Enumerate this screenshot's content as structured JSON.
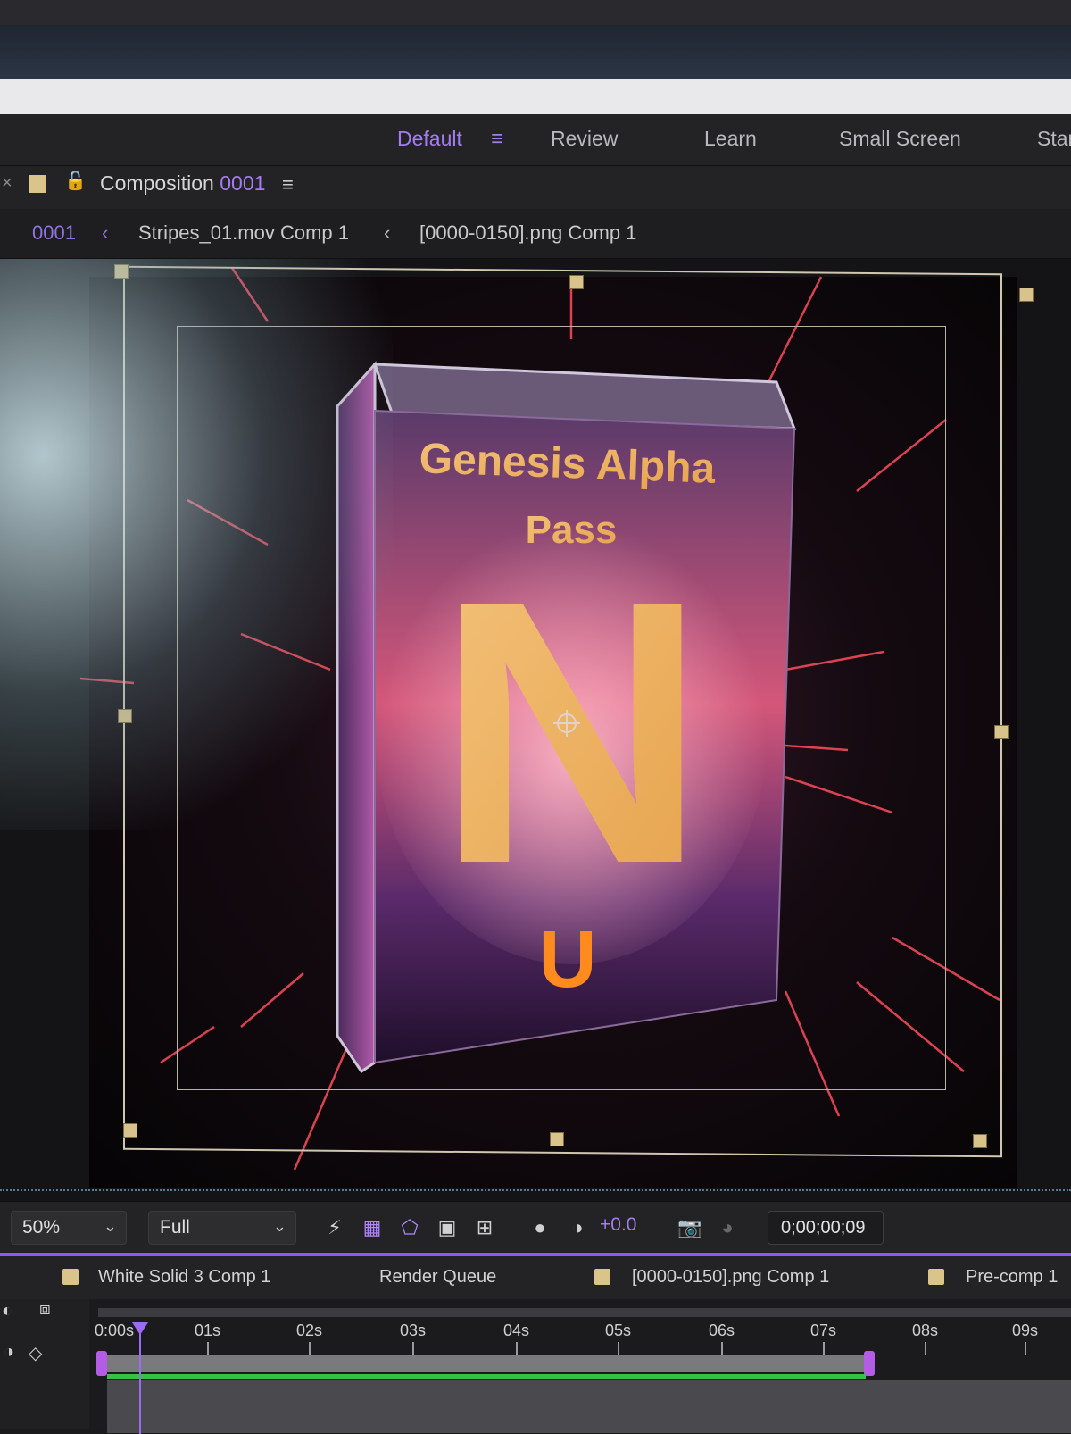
{
  "workspaces": [
    {
      "label": "Default",
      "active": true
    },
    {
      "label": "Review",
      "active": false
    },
    {
      "label": "Learn",
      "active": false
    },
    {
      "label": "Small Screen",
      "active": false
    },
    {
      "label": "Star",
      "active": false
    }
  ],
  "panel": {
    "title": "Composition",
    "comp_number": "0001"
  },
  "breadcrumbs": [
    "0001",
    "Stripes_01.mov Comp 1",
    "[0000-0150].png Comp 1"
  ],
  "artwork": {
    "title_line1": "Genesis Alpha",
    "title_line2": "Pass",
    "letter": "N",
    "logo_letter": "U"
  },
  "toolbar": {
    "zoom": "50%",
    "resolution": "Full",
    "exposure": "+0.0",
    "timecode": "0;00;00;09"
  },
  "timeline_tabs": [
    "White Solid 3 Comp 1",
    "Render Queue",
    "[0000-0150].png Comp 1",
    "Pre-comp 1"
  ],
  "ruler": {
    "start": "0:00s",
    "ticks": [
      "01s",
      "02s",
      "03s",
      "04s",
      "05s",
      "06s",
      "07s",
      "08s",
      "09s"
    ]
  },
  "colors": {
    "accent": "#a37cf0",
    "work_area_marker": "#b55ce6",
    "green_bar": "#35c24a",
    "label_yellow": "#d9c48a"
  }
}
